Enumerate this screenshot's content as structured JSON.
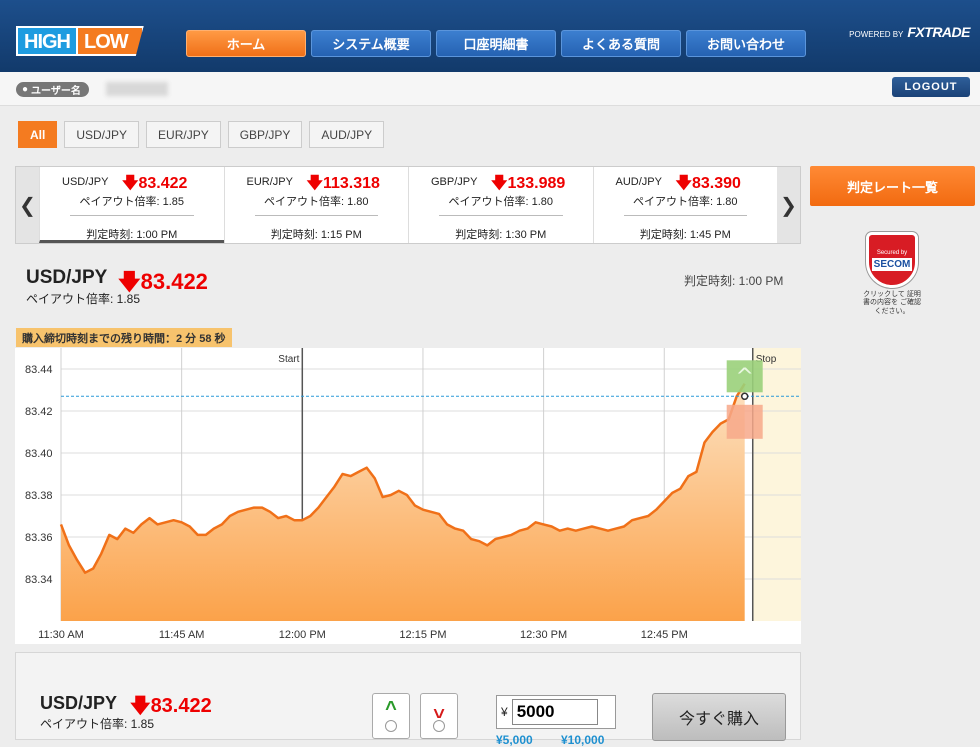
{
  "header": {
    "logo_left": "HIGH",
    "logo_right": "LOW",
    "nav": [
      "ホーム",
      "システム概要",
      "口座明細書",
      "よくある質問",
      "お問い合わせ"
    ],
    "powered_by": "POWERED BY",
    "brand": "FXTRADE"
  },
  "userbar": {
    "username_label": "ユーザー名",
    "logout": "LOGOUT"
  },
  "tabs": [
    "All",
    "USD/JPY",
    "EUR/JPY",
    "GBP/JPY",
    "AUD/JPY"
  ],
  "ticker": [
    {
      "pair": "USD/JPY",
      "rate": "83.422",
      "payout": "ペイアウト倍率: 1.85",
      "expiry": "判定時刻: 1:00 PM"
    },
    {
      "pair": "EUR/JPY",
      "rate": "113.318",
      "payout": "ペイアウト倍率: 1.80",
      "expiry": "判定時刻: 1:15 PM"
    },
    {
      "pair": "GBP/JPY",
      "rate": "133.989",
      "payout": "ペイアウト倍率: 1.80",
      "expiry": "判定時刻: 1:30 PM"
    },
    {
      "pair": "AUD/JPY",
      "rate": "83.390",
      "payout": "ペイアウト倍率: 1.80",
      "expiry": "判定時刻: 1:45 PM"
    }
  ],
  "side": {
    "rate_list_button": "判定レート一覧",
    "seal_top": "Secured by",
    "seal_brand": "SECOM",
    "seal_note": "クリックして 証明書の内容を ご確認ください。"
  },
  "main": {
    "pair": "USD/JPY",
    "rate": "83.422",
    "payout": "ペイアウト倍率: 1.85",
    "expiry": "判定時刻: 1:00 PM",
    "countdown": "購入締切時刻までの残り時間：2 分 58 秒"
  },
  "chart_data": {
    "type": "area",
    "title": "",
    "xlabel": "",
    "ylabel": "",
    "x_ticks": [
      "11:30 AM",
      "11:45 AM",
      "12:00 PM",
      "12:15 PM",
      "12:30 PM",
      "12:45 PM"
    ],
    "y_ticks": [
      83.34,
      83.36,
      83.38,
      83.4,
      83.42,
      83.44
    ],
    "ylim": [
      83.32,
      83.45
    ],
    "xlim_minutes": [
      0,
      92
    ],
    "start_label": "Start",
    "stop_label": "Stop",
    "start_minute": 30,
    "stop_minute": 86,
    "current_rate": 83.427,
    "series": [
      {
        "x_minutes": [
          0,
          1,
          2,
          3,
          4,
          5,
          6,
          7,
          8,
          9,
          10,
          11,
          12,
          13,
          14,
          15,
          16,
          17,
          18,
          19,
          20,
          21,
          22,
          23,
          24,
          25,
          26,
          27,
          28,
          29,
          30,
          31,
          32,
          33,
          34,
          35,
          36,
          37,
          38,
          39,
          40,
          41,
          42,
          43,
          44,
          45,
          46,
          47,
          48,
          49,
          50,
          51,
          52,
          53,
          54,
          55,
          56,
          57,
          58,
          59,
          60,
          61,
          62,
          63,
          64,
          65,
          66,
          67,
          68,
          69,
          70,
          71,
          72,
          73,
          74,
          75,
          76,
          77,
          78,
          79,
          80,
          81,
          82,
          83,
          84,
          85
        ],
        "values": [
          83.366,
          83.356,
          83.349,
          83.343,
          83.345,
          83.352,
          83.361,
          83.359,
          83.364,
          83.362,
          83.366,
          83.369,
          83.366,
          83.367,
          83.368,
          83.367,
          83.365,
          83.361,
          83.361,
          83.364,
          83.366,
          83.37,
          83.372,
          83.373,
          83.374,
          83.374,
          83.372,
          83.369,
          83.37,
          83.368,
          83.368,
          83.37,
          83.374,
          83.379,
          83.384,
          83.39,
          83.389,
          83.391,
          83.393,
          83.388,
          83.379,
          83.38,
          83.382,
          83.38,
          83.375,
          83.373,
          83.372,
          83.371,
          83.366,
          83.364,
          83.363,
          83.359,
          83.358,
          83.356,
          83.359,
          83.36,
          83.361,
          83.363,
          83.364,
          83.367,
          83.366,
          83.365,
          83.363,
          83.364,
          83.363,
          83.364,
          83.365,
          83.364,
          83.363,
          83.364,
          83.365,
          83.368,
          83.369,
          83.37,
          83.373,
          83.377,
          83.381,
          83.383,
          83.389,
          83.391,
          83.405,
          83.41,
          83.414,
          83.416,
          83.427,
          83.433
        ]
      }
    ]
  },
  "panel": {
    "pair": "USD/JPY",
    "rate": "83.422",
    "payout": "ペイアウト倍率: 1.85",
    "yen_sign": "¥",
    "amount": "5000",
    "quick_amounts": [
      "¥5,000",
      "¥10,000"
    ],
    "buy_button": "今すぐ購入",
    "high_icon": "chevron-up-icon",
    "low_icon": "chevron-down-icon"
  },
  "colors": {
    "accent": "#f47b20",
    "down": "#e00000",
    "nav": "#2562b2",
    "line": "#f07018"
  }
}
